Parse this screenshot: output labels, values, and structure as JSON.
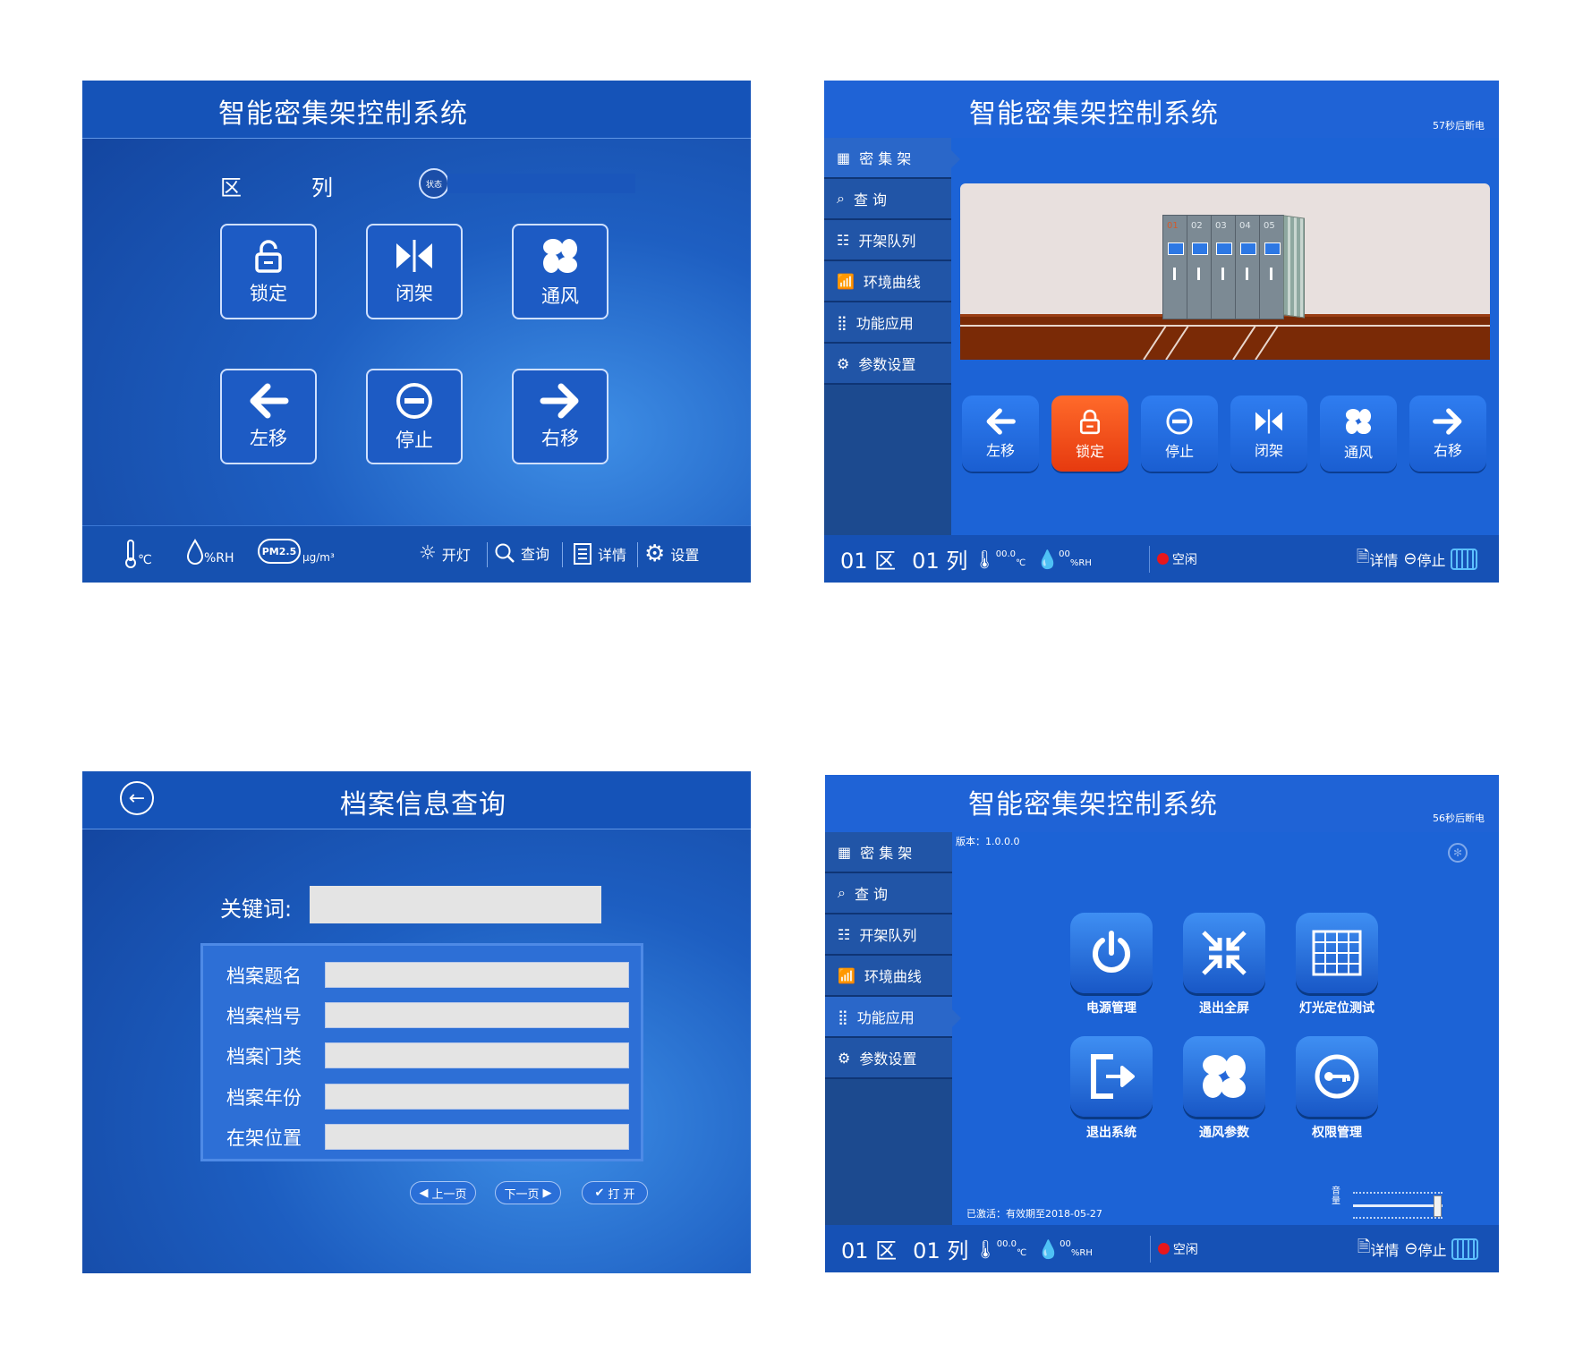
{
  "panel1": {
    "title": "智能密集架控制系统",
    "zone_label": "区",
    "column_label": "列",
    "status_badge": "状态",
    "buttons": [
      {
        "label": "锁定",
        "icon": "lock-open-icon"
      },
      {
        "label": "闭架",
        "icon": "close-shelf-icon"
      },
      {
        "label": "通风",
        "icon": "fan-icon"
      },
      {
        "label": "左移",
        "icon": "arrow-left-icon"
      },
      {
        "label": "停止",
        "icon": "stop-icon"
      },
      {
        "label": "右移",
        "icon": "arrow-right-icon"
      }
    ],
    "footer": {
      "temp_unit": "℃",
      "humidity_unit": "%RH",
      "pm_label": "PM2.5",
      "pm_unit": "μg/m³",
      "light": "开灯",
      "query": "查询",
      "detail": "详情",
      "settings": "设置"
    }
  },
  "panel2": {
    "title": "智能密集架控制系统",
    "power_off_timer": "57秒后断电",
    "sidebar": [
      {
        "label": "密 集 架",
        "icon": "shelf-grid-icon"
      },
      {
        "label": "查    询",
        "icon": "search-icon"
      },
      {
        "label": "开架队列",
        "icon": "queue-icon"
      },
      {
        "label": "环境曲线",
        "icon": "chart-icon"
      },
      {
        "label": "功能应用",
        "icon": "apps-icon"
      },
      {
        "label": "参数设置",
        "icon": "gear-icon"
      }
    ],
    "shelf_numbers": [
      "01",
      "02",
      "03",
      "04",
      "05"
    ],
    "controls": [
      {
        "label": "左移",
        "icon": "arrow-left-icon"
      },
      {
        "label": "锁定",
        "icon": "lock-icon"
      },
      {
        "label": "停止",
        "icon": "stop-icon"
      },
      {
        "label": "闭架",
        "icon": "close-shelf-icon"
      },
      {
        "label": "通风",
        "icon": "fan-icon"
      },
      {
        "label": "右移",
        "icon": "arrow-right-icon"
      }
    ],
    "status": {
      "zone": "01 区",
      "column": "01 列",
      "temp": "00.0",
      "temp_unit": "℃",
      "humidity": "00",
      "humidity_unit": "%RH",
      "state": "空闲",
      "detail": "详情",
      "stop": "停止"
    }
  },
  "panel3": {
    "title": "档案信息查询",
    "keyword_label": "关键词:",
    "fields": [
      {
        "label": "档案题名"
      },
      {
        "label": "档案档号"
      },
      {
        "label": "档案门类"
      },
      {
        "label": "档案年份"
      },
      {
        "label": "在架位置"
      }
    ],
    "prev": "上一页",
    "next": "下一页",
    "open": "打 开"
  },
  "panel4": {
    "title": "智能密集架控制系统",
    "power_off_timer": "56秒后断电",
    "version": "版本：1.0.0.0",
    "sidebar": [
      {
        "label": "密 集 架",
        "icon": "shelf-grid-icon"
      },
      {
        "label": "查    询",
        "icon": "search-icon"
      },
      {
        "label": "开架队列",
        "icon": "queue-icon"
      },
      {
        "label": "环境曲线",
        "icon": "chart-icon"
      },
      {
        "label": "功能应用",
        "icon": "apps-icon"
      },
      {
        "label": "参数设置",
        "icon": "gear-icon"
      }
    ],
    "apps": [
      {
        "label": "电源管理",
        "icon": "power-icon"
      },
      {
        "label": "退出全屏",
        "icon": "exit-fullscreen-icon"
      },
      {
        "label": "灯光定位测试",
        "icon": "light-grid-icon"
      },
      {
        "label": "退出系统",
        "icon": "logout-icon"
      },
      {
        "label": "通风参数",
        "icon": "fan-icon"
      },
      {
        "label": "权限管理",
        "icon": "key-icon"
      }
    ],
    "activation": "已激活：有效期至2018-05-27",
    "volume_label": "音量",
    "volume_level": 0.9,
    "status": {
      "zone": "01 区",
      "column": "01 列",
      "temp": "00.0",
      "temp_unit": "℃",
      "humidity": "00",
      "humidity_unit": "%RH",
      "state": "空闲",
      "detail": "详情",
      "stop": "停止"
    }
  },
  "colors": {
    "header_blue": "#1f63d6",
    "sidebar_blue": "#1c4a8f",
    "lock_orange": "#f05a1e",
    "status_red": "#e8161b"
  }
}
